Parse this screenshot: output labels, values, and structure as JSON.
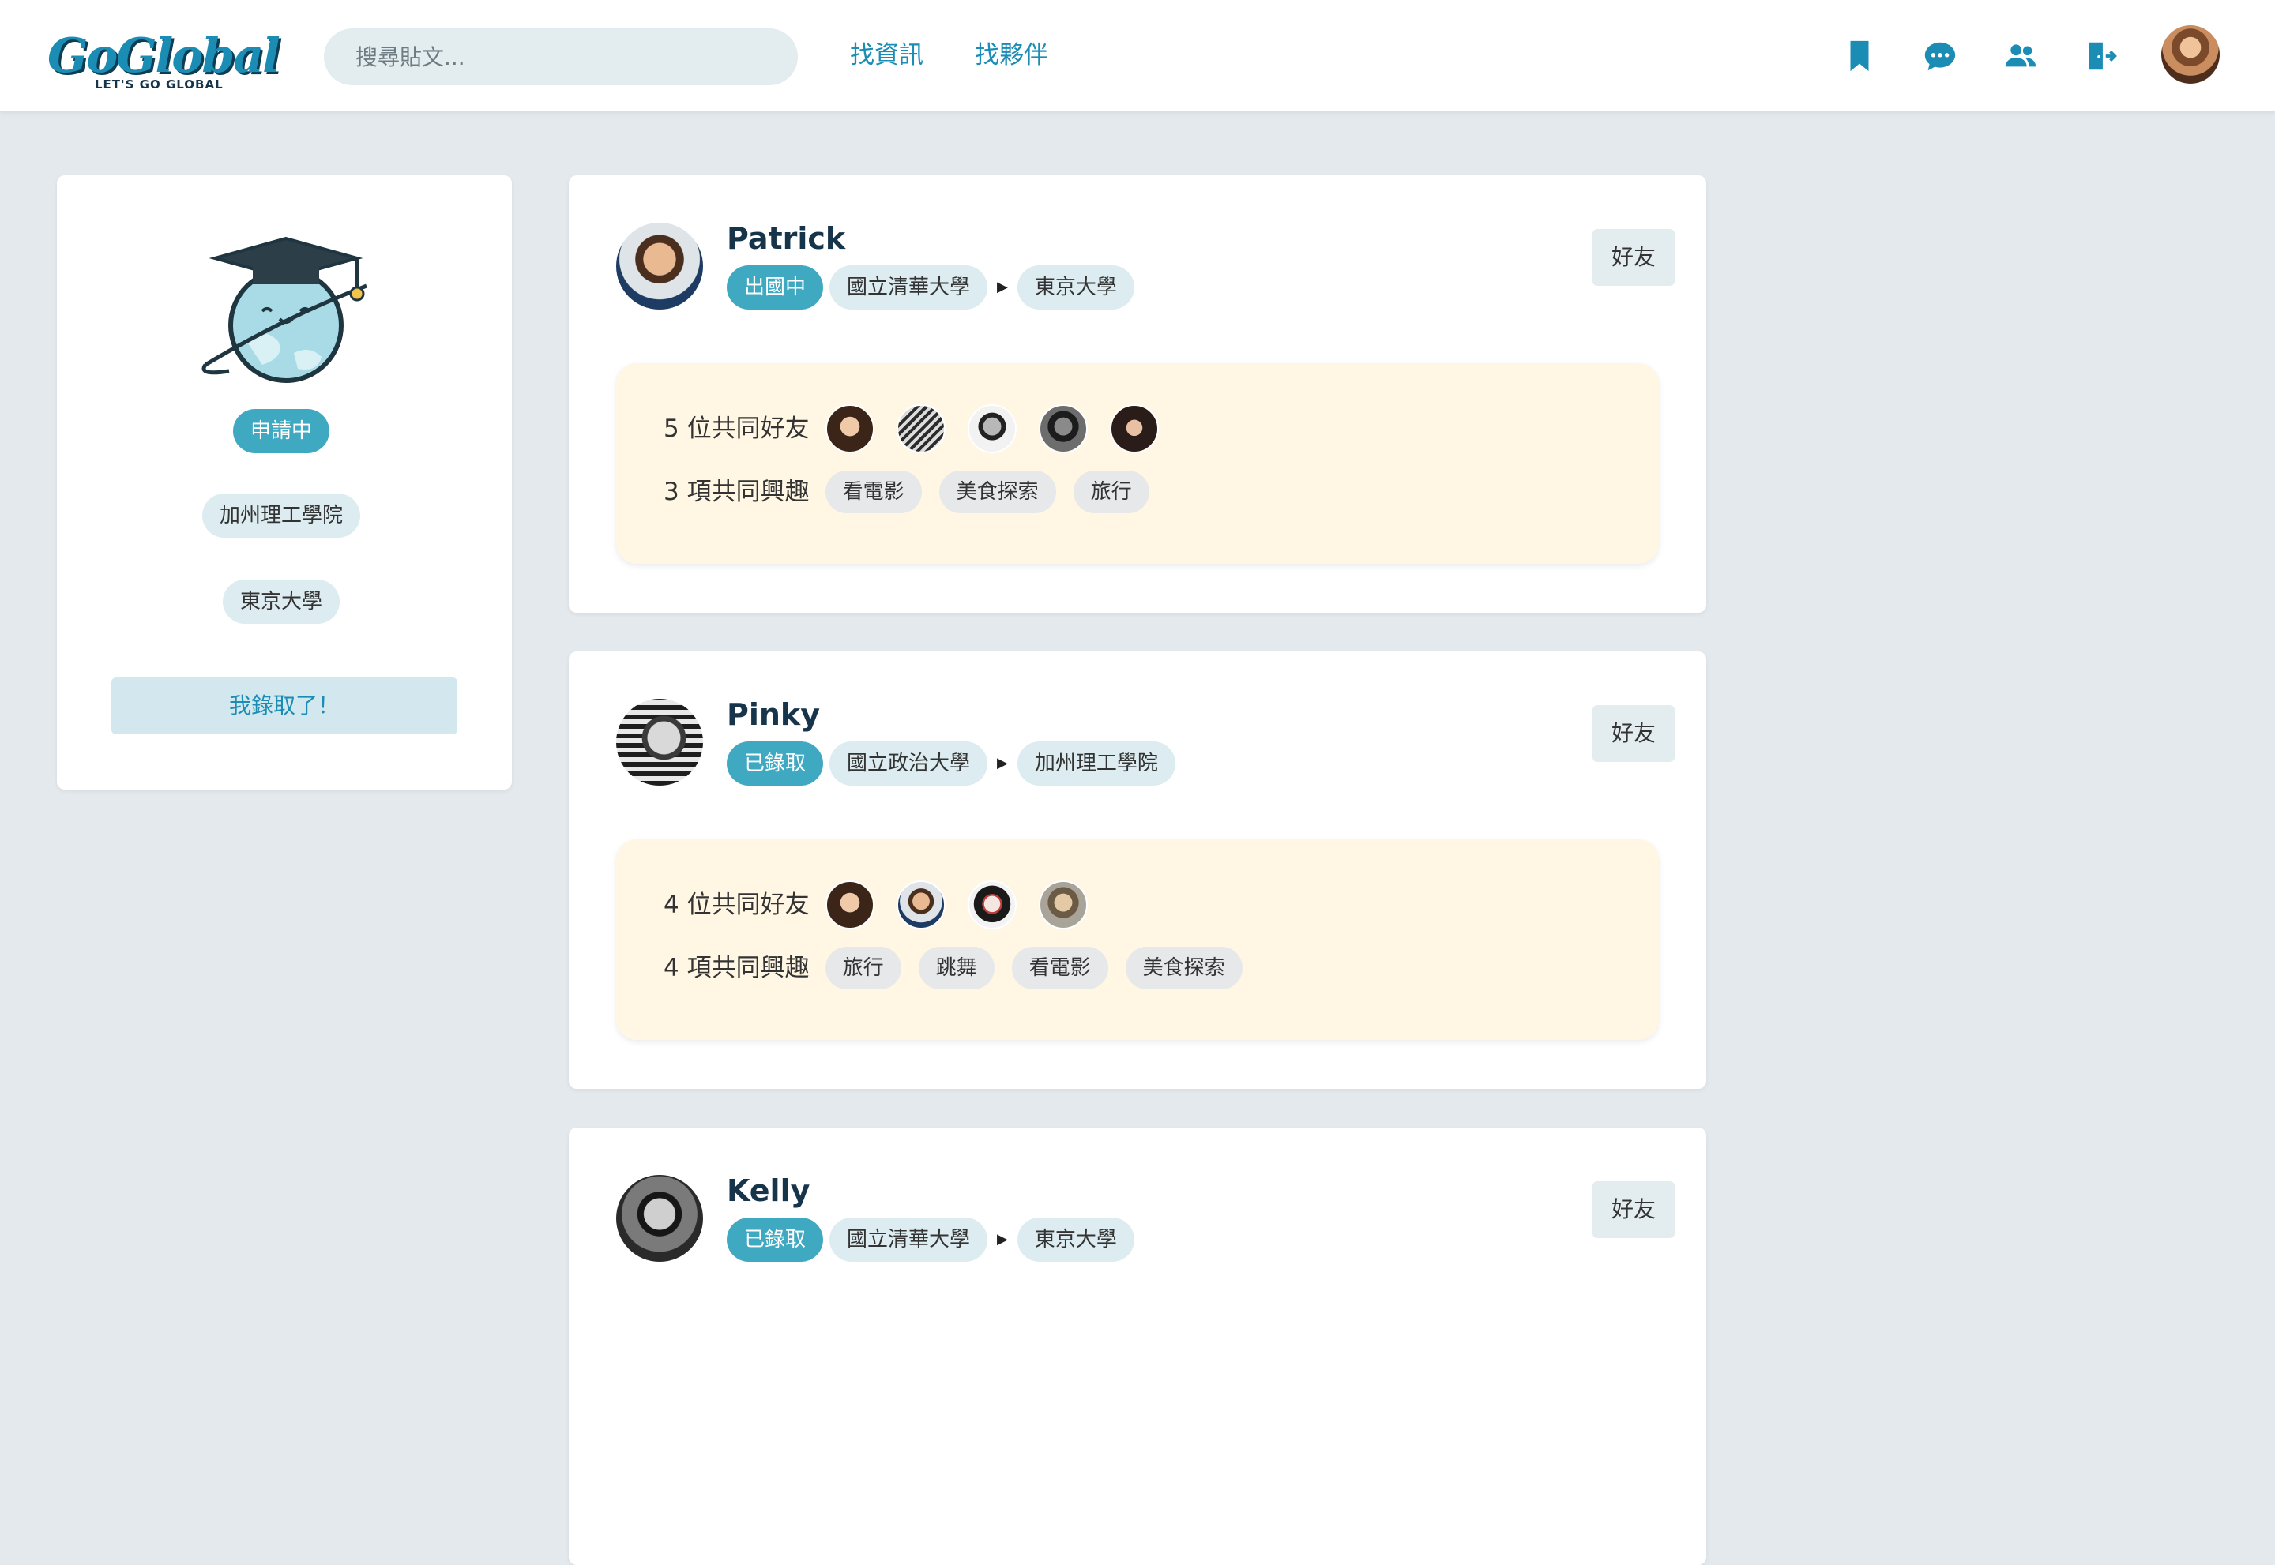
{
  "header": {
    "logo_text": "GoGlobal",
    "logo_tagline": "LET'S GO GLOBAL",
    "search_placeholder": "搜尋貼文...",
    "nav": [
      {
        "label": "找資訊"
      },
      {
        "label": "找夥伴"
      }
    ],
    "icons": [
      "bookmark-icon",
      "chat-icon",
      "friends-icon",
      "logout-icon"
    ],
    "accent_color": "#1b8db5"
  },
  "profile": {
    "status": "申請中",
    "schools": [
      "加州理工學院",
      "東京大學"
    ],
    "accepted_button": "我錄取了！"
  },
  "users": [
    {
      "name": "Patrick",
      "status": "出國中",
      "from_school": "國立清華大學",
      "to_school": "東京大學",
      "friend_button": "好友",
      "mutual_friends_label": "5 位共同好友",
      "mutual_friend_count": 5,
      "interests_label": "3 項共同興趣",
      "interests": [
        "看電影",
        "美食探索",
        "旅行"
      ]
    },
    {
      "name": "Pinky",
      "status": "已錄取",
      "from_school": "國立政治大學",
      "to_school": "加州理工學院",
      "friend_button": "好友",
      "mutual_friends_label": "4 位共同好友",
      "mutual_friend_count": 4,
      "interests_label": "4 項共同興趣",
      "interests": [
        "旅行",
        "跳舞",
        "看電影",
        "美食探索"
      ]
    },
    {
      "name": "Kelly",
      "status": "已錄取",
      "from_school": "國立清華大學",
      "to_school": "東京大學",
      "friend_button": "好友"
    }
  ],
  "colors": {
    "status_pill": "#3fa9c2",
    "school_pill": "#dcecf0",
    "common_box": "#fff6e4",
    "page_bg": "#e3e9ec"
  }
}
